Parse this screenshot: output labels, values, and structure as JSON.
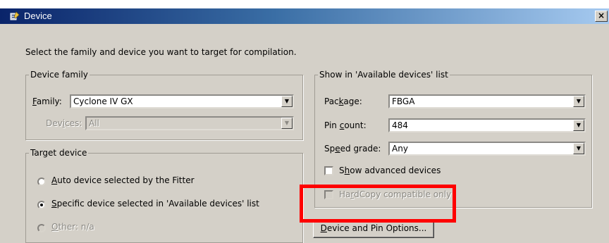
{
  "window": {
    "title": "Device",
    "close_symbol": "×",
    "icon": "device-settings-icon"
  },
  "intro_text": "Select the family and device you want to target for compilation.",
  "device_family": {
    "group_label": "Device family",
    "family_label": {
      "before": "",
      "mnemonic": "F",
      "after": "amily:"
    },
    "family_value": "Cyclone IV GX",
    "devices_label": {
      "before": "Dev",
      "mnemonic": "i",
      "after": "ces:"
    },
    "devices_value": "All"
  },
  "target_device": {
    "group_label": "Target device",
    "options": [
      {
        "before": "",
        "mnemonic": "A",
        "after": "uto device selected by the Fitter",
        "selected": false,
        "enabled": true
      },
      {
        "before": "",
        "mnemonic": "S",
        "after": "pecific device selected in 'Available devices' list",
        "selected": true,
        "enabled": true
      },
      {
        "before": "",
        "mnemonic": "O",
        "after": "ther:  n/a",
        "selected": false,
        "enabled": false
      }
    ]
  },
  "show_list": {
    "group_label": "Show in 'Available devices' list",
    "package_label": {
      "before": "Pac",
      "mnemonic": "k",
      "after": "age:"
    },
    "package_value": "FBGA",
    "pin_count_label": {
      "before": "Pin ",
      "mnemonic": "c",
      "after": "ount:"
    },
    "pin_count_value": "484",
    "speed_grade_label": {
      "before": "Sp",
      "mnemonic": "e",
      "after": "ed grade:"
    },
    "speed_grade_value": "Any",
    "show_advanced": {
      "before": "S",
      "mnemonic": "h",
      "after": "ow advanced devices",
      "checked": false
    },
    "hardcopy": {
      "before": "Ha",
      "mnemonic": "r",
      "after": "dCopy compatible only",
      "checked": false,
      "enabled": false
    }
  },
  "buttons": {
    "device_pin_options": {
      "before": "",
      "mnemonic": "D",
      "after": "evice and Pin Options..."
    }
  },
  "colors": {
    "dialog_bg": "#d4d0c8",
    "titlebar_start": "#0a246a",
    "titlebar_end": "#a6caf0",
    "highlight": "#ff0000"
  }
}
